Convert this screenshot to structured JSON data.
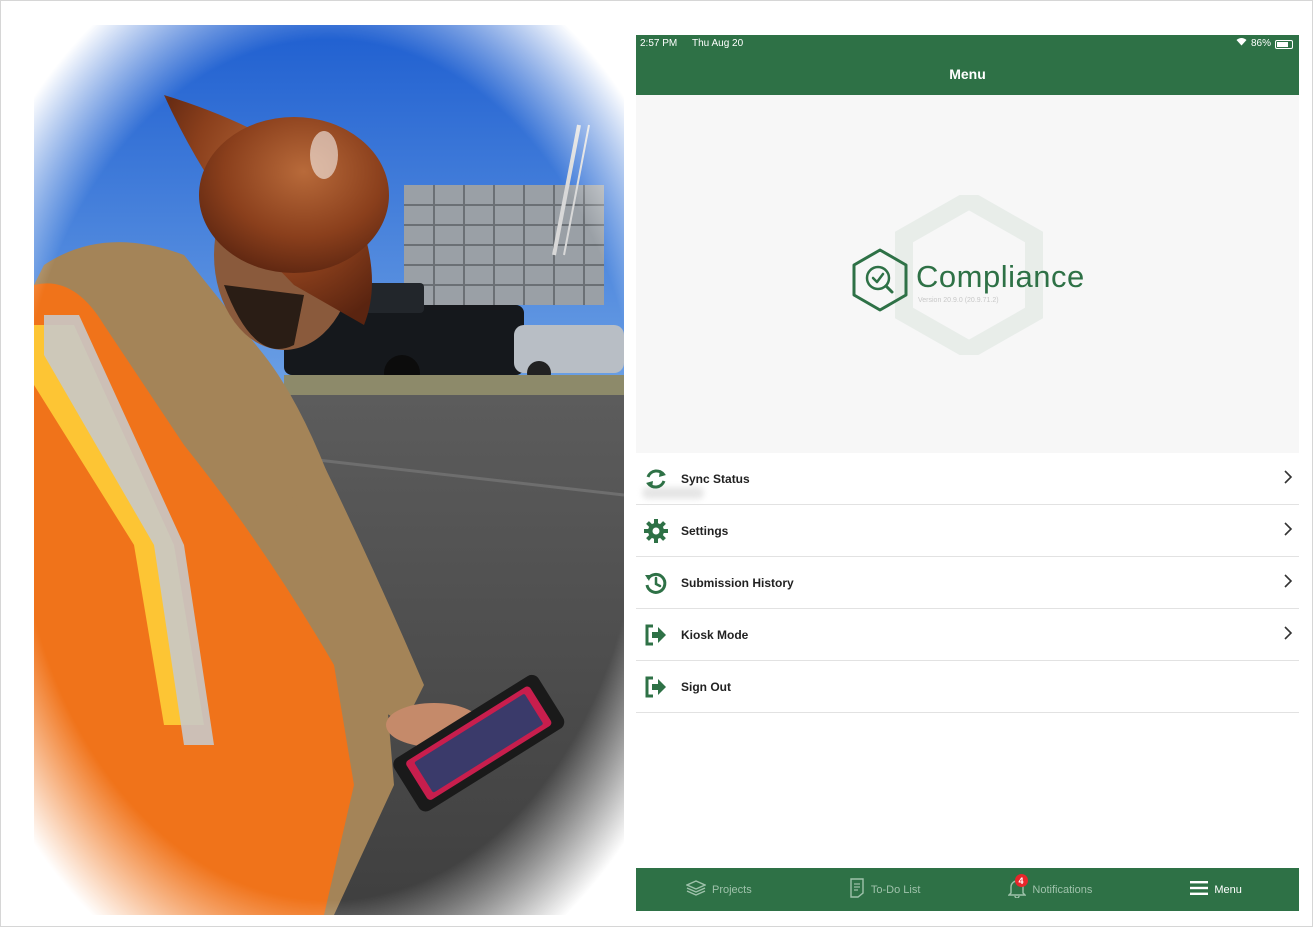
{
  "photo": {
    "alt": "Construction worker in hard hat and safety vest using a tablet"
  },
  "status_bar": {
    "time": "2:57 PM",
    "date": "Thu Aug 20",
    "battery": "86%"
  },
  "nav": {
    "title": "Menu"
  },
  "app": {
    "name": "Compliance",
    "version": "Version 20.9.0 (20.9.71.2)"
  },
  "menu": {
    "items": [
      {
        "label": "Sync Status",
        "icon": "sync-icon"
      },
      {
        "label": "Settings",
        "icon": "gear-icon"
      },
      {
        "label": "Submission History",
        "icon": "history-icon"
      },
      {
        "label": "Kiosk Mode",
        "icon": "kiosk-icon"
      },
      {
        "label": "Sign Out",
        "icon": "sign-out-icon"
      }
    ]
  },
  "tabs": {
    "projects": "Projects",
    "todo": "To-Do List",
    "notifications": "Notifications",
    "notifications_badge": "4",
    "menu": "Menu"
  },
  "colors": {
    "brand_green": "#2e7146",
    "badge_red": "#e8262b"
  }
}
